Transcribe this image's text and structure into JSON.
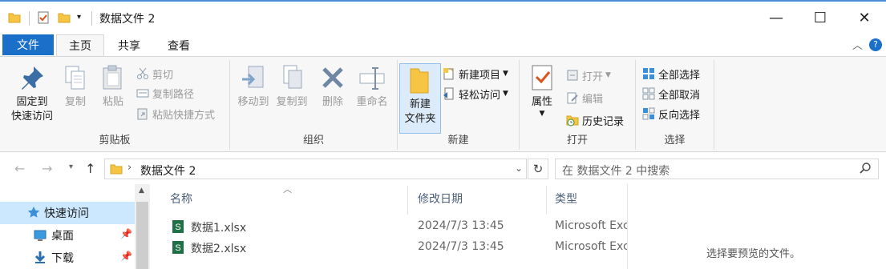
{
  "window": {
    "title": "数据文件 2",
    "controls": {
      "minimize": "—",
      "maximize": "☐",
      "close": "✕"
    }
  },
  "tabs": {
    "file": "文件",
    "home": "主页",
    "share": "共享",
    "view": "查看"
  },
  "ribbon": {
    "clipboard": {
      "label": "剪贴板",
      "pin_line1": "固定到",
      "pin_line2": "快速访问",
      "copy": "复制",
      "paste": "粘贴",
      "cut": "剪切",
      "copy_path": "复制路径",
      "paste_shortcut": "粘贴快捷方式"
    },
    "organize": {
      "label": "组织",
      "move_to": "移动到",
      "copy_to": "复制到",
      "delete": "删除",
      "rename": "重命名"
    },
    "new": {
      "label": "新建",
      "new_folder_line1": "新建",
      "new_folder_line2": "文件夹",
      "new_item": "新建项目",
      "easy_access": "轻松访问"
    },
    "open": {
      "label": "打开",
      "properties": "属性",
      "open": "打开",
      "edit": "编辑",
      "history": "历史记录"
    },
    "select": {
      "label": "选择",
      "select_all": "全部选择",
      "select_none": "全部取消",
      "invert": "反向选择"
    }
  },
  "address": {
    "path": "数据文件 2",
    "search_placeholder": "在 数据文件 2 中搜索"
  },
  "nav": {
    "quick_access": "快速访问",
    "desktop": "桌面",
    "downloads": "下载"
  },
  "files": {
    "columns": {
      "name": "名称",
      "modified": "修改日期",
      "type": "类型"
    },
    "rows": [
      {
        "name": "数据1.xlsx",
        "modified": "2024/7/3 13:45",
        "type": "Microsoft Excel"
      },
      {
        "name": "数据2.xlsx",
        "modified": "2024/7/3 13:45",
        "type": "Microsoft Excel"
      }
    ]
  },
  "preview": {
    "message": "选择要预览的文件。"
  },
  "colors": {
    "accent": "#1a6fc9",
    "folder": "#f5c543",
    "excel": "#1e7145",
    "selected": "#cce8ff"
  }
}
